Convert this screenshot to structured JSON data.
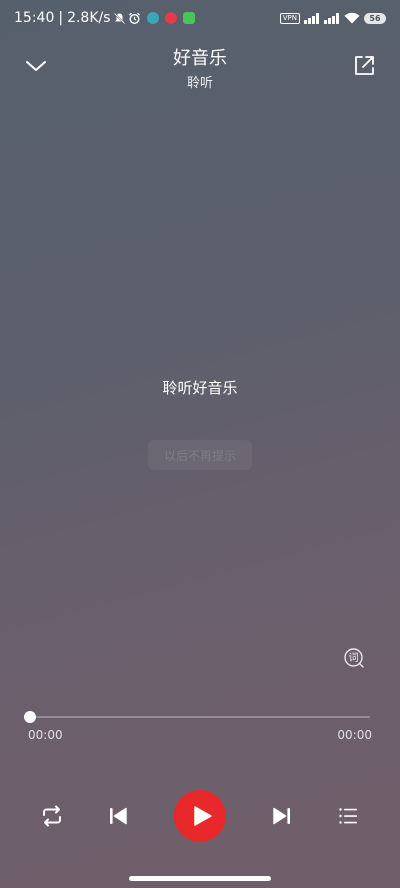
{
  "status_bar": {
    "time": "15:40",
    "separator": "|",
    "net_speed": "2.8K/s",
    "vpn_label": "VPN",
    "battery": "56"
  },
  "header": {
    "title": "好音乐",
    "subtitle": "聆听",
    "back_icon": "chevron-down-icon",
    "share_icon": "external-share-icon"
  },
  "lyrics": {
    "current_line": "聆听好音乐",
    "hint": "以后不再提示",
    "lyrics_button_glyph": "词"
  },
  "progress": {
    "current_time": "00:00",
    "total_time": "00:00",
    "played_fraction": 0
  },
  "controls": {
    "repeat_icon": "repeat-icon",
    "prev_icon": "skip-previous-icon",
    "play_icon": "play-icon",
    "next_icon": "skip-next-icon",
    "playlist_icon": "playlist-icon"
  },
  "colors": {
    "play_button": "#e8282a",
    "app_icon_teal": "#3aa6b9",
    "app_icon_red": "#e23b4a",
    "app_icon_green": "#4cc25a"
  }
}
